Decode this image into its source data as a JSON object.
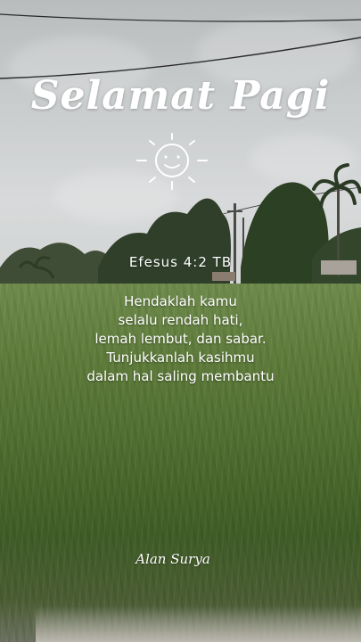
{
  "greeting": {
    "title": "Selamat Pagi"
  },
  "scripture": {
    "reference": "Efesus 4:2 TB",
    "lines": [
      "Hendaklah kamu",
      "selalu rendah hati,",
      "lemah lembut, dan sabar.",
      "Tunjukkanlah kasihmu",
      "dalam hal saling membantu"
    ]
  },
  "author": {
    "name": "Alan Surya"
  },
  "icons": {
    "sun": "smiling-sun-icon"
  },
  "colors": {
    "text": "#ffffff",
    "sky": "#c9cccd",
    "field": "#5f7c3b"
  }
}
